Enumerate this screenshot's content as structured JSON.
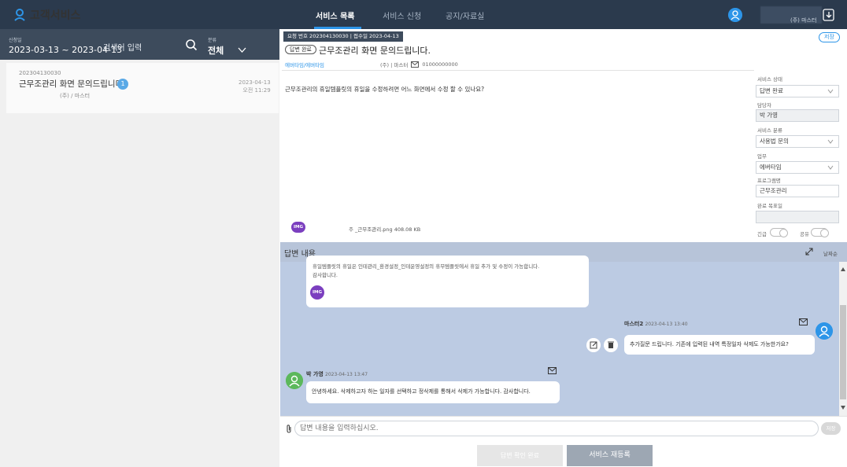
{
  "app": {
    "title": "고객서비스"
  },
  "nav": {
    "items": [
      "서비스 목록",
      "서비스 신청",
      "공지/자료실"
    ],
    "active_index": 0
  },
  "user": {
    "company": "(주) 마스터"
  },
  "filter": {
    "date_label": "신청일",
    "date_range": "2023-03-13 ~ 2023-04-13",
    "search_placeholder": "검색어 입력",
    "category_label": "분류",
    "category_value": "전체"
  },
  "list": [
    {
      "no": "202304130030",
      "title": "근무조관리 화면 문의드립니다.",
      "badge": "1",
      "company": "(주) / 마스터",
      "date": "2023-04-13",
      "time": "오전 11:29"
    }
  ],
  "detail": {
    "meta": "요청 번호 202304130030 | 접수일 2023-04-13",
    "status": "답변 완료",
    "title": "근무조관리 화면 문의드립니다.",
    "tag": "에버타임/에버타임",
    "contact_company": "(주) | 마스터",
    "contact_phone": "01000000000",
    "save_label": "저장",
    "question": "근무조관리의 휴일템플릿의 휴일을 수정하려면 어느 화면에서 수정 할 수 있나요?",
    "attachment_badge": "IMG",
    "attachment_name": "주 _근무조관리.png 408.08 KB"
  },
  "form": {
    "service_status_label": "서비스 상태",
    "service_status": "답변 완료",
    "assignee_label": "담당자",
    "assignee": "박 가영",
    "service_category_label": "서비스 분류",
    "service_category": "사용법 문의",
    "work_label": "업무",
    "work": "에버타임",
    "program_label": "프로그램명",
    "program": "근무조관리",
    "due_label": "완료 목표일",
    "due": "",
    "urgent_label": "긴급",
    "share_label": "공유"
  },
  "answers": {
    "title": "답변 내용",
    "sort_label": "날짜순",
    "first_text_line1": "휴일템플릿의 휴일은 인테관리_환경설정_인테운영설정의 휴무템플릿에서 휴일 추가 및 수정이 가능합니다.",
    "first_text_line2": "감사합니다.",
    "first_badge": "IMG",
    "second_name": "마스터2",
    "second_time": "2023-04-13 13:40",
    "second_text": "추가질문 드립니다. 기존에 입력된 내역 특정일자 삭제도 가능한가요?",
    "third_name": "박 가영",
    "third_time": "2023-04-13 13:47",
    "third_text": "안녕하세요. 삭제하고자 하는 일자를 선택하고 정삭제를 통해서 삭제가 가능합니다. 감사합니다."
  },
  "input": {
    "placeholder": "답변 내용을 입력하십시오.",
    "send_label": "저장"
  },
  "footer": {
    "confirm_label": "답변 확인 완료",
    "reregister_label": "서비스 재등록"
  },
  "colors": {
    "topbar": "#2b3a4d",
    "accent": "#2d95e8",
    "answer_bg": "#bccbe3",
    "img_badge": "#7b3fbf"
  }
}
